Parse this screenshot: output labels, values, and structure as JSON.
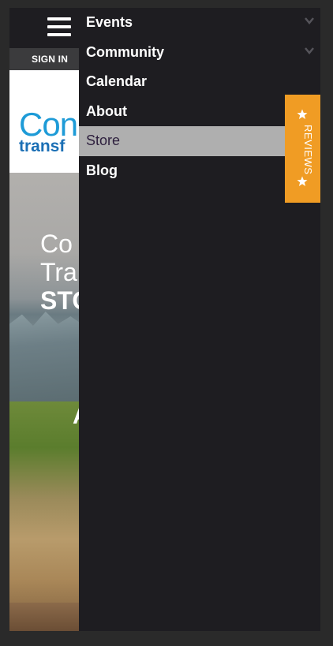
{
  "header": {
    "menu_icon": "hamburger-menu-icon",
    "signin_label": "SIGN IN"
  },
  "logo": {
    "line1": "Con",
    "line2": "transf"
  },
  "hero": {
    "line1": "Co",
    "line2": "Tra",
    "line3": "STO",
    "fragment": "A"
  },
  "menu": {
    "items": [
      {
        "label": "Events",
        "has_submenu": true,
        "icon": "chevron-down-icon"
      },
      {
        "label": "Community",
        "has_submenu": true,
        "icon": "chevron-down-icon"
      },
      {
        "label": "Calendar",
        "has_submenu": false
      },
      {
        "label": "About",
        "has_submenu": false
      },
      {
        "label": "Store",
        "has_submenu": false,
        "active": true
      },
      {
        "label": "Blog",
        "has_submenu": false
      }
    ]
  },
  "reviews_tab": {
    "label": "REVIEWS",
    "icon": "star-icon",
    "color": "#f09c24"
  },
  "colors": {
    "menu_bg": "#1e1d21",
    "active_bg": "#afafaf",
    "active_text": "#2d1f3d",
    "logo_blue": "#1e9bd7"
  }
}
